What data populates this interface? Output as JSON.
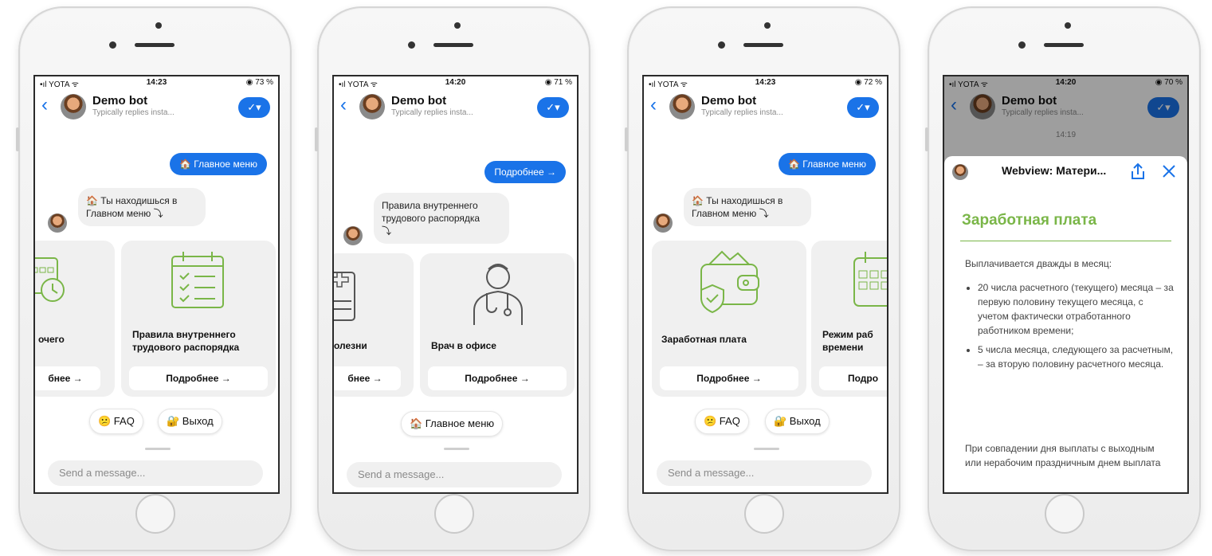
{
  "phones": [
    {
      "status": {
        "carrier": "•ıl YOTA ᯤ",
        "time": "14:23",
        "battery": "◉ 73 %"
      },
      "header": {
        "bot_name": "Demo bot",
        "subtitle": "Typically replies insta..."
      },
      "outgoing": "🏠 Главное меню",
      "incoming": [
        "🏠 Ты находишься в",
        "Главном меню ⤵"
      ],
      "cards": [
        {
          "title": [
            "очего"
          ],
          "button": "бнее →"
        },
        {
          "title": [
            "Правила внутреннего",
            "трудового распорядка"
          ],
          "button": "Подробнее →"
        }
      ],
      "quick_replies": [
        "😕 FAQ",
        "🔐 Выход"
      ],
      "input_placeholder": "Send a message..."
    },
    {
      "status": {
        "carrier": "•ıl YOTA ᯤ",
        "time": "14:20",
        "battery": "◉ 71 %"
      },
      "header": {
        "bot_name": "Demo bot",
        "subtitle": "Typically replies insta..."
      },
      "outgoing": "Подробнее →",
      "incoming": [
        "Правила внутреннего",
        "трудового распорядка",
        "⤵"
      ],
      "cards": [
        {
          "title": [
            "олезни"
          ],
          "button": "бнее →"
        },
        {
          "title": [
            "Врач в офисе"
          ],
          "button": "Подробнее →"
        }
      ],
      "quick_replies": [
        "🏠 Главное меню"
      ],
      "input_placeholder": "Send a message..."
    },
    {
      "status": {
        "carrier": "•ıl YOTA ᯤ",
        "time": "14:23",
        "battery": "◉ 72 %"
      },
      "header": {
        "bot_name": "Demo bot",
        "subtitle": "Typically replies insta..."
      },
      "outgoing": "🏠 Главное меню",
      "incoming": [
        "🏠 Ты находишься в",
        "Главном меню ⤵"
      ],
      "cards": [
        {
          "title": [
            "Заработная плата"
          ],
          "button": "Подробнее →"
        },
        {
          "title": [
            "Режим раб",
            "времени"
          ],
          "button": "Подро"
        }
      ],
      "quick_replies": [
        "😕 FAQ",
        "🔐 Выход"
      ],
      "input_placeholder": "Send a message..."
    },
    {
      "status": {
        "carrier": "•ıl YOTA ᯤ",
        "time": "14:20",
        "battery": "◉ 70 %"
      },
      "header": {
        "bot_name": "Demo bot",
        "subtitle": "Typically replies insta...",
        "time": "14:19"
      },
      "webview": {
        "title": "Webview: Матери...",
        "heading": "Заработная плата",
        "intro": "Выплачивается дважды в месяц:",
        "items": [
          "20 числа расчетного (текущего) месяца – за первую половину текущего месяца, с учетом фактически отработанного работником времени;",
          "5 числа месяца, следующего за расчетным, – за вторую половину расчетного месяца."
        ],
        "outro": "При совпадении дня выплаты с выходным или нерабочим праздничным днем выплата"
      }
    }
  ],
  "colors": {
    "accent": "#1a73e8",
    "green": "#7ab648"
  }
}
